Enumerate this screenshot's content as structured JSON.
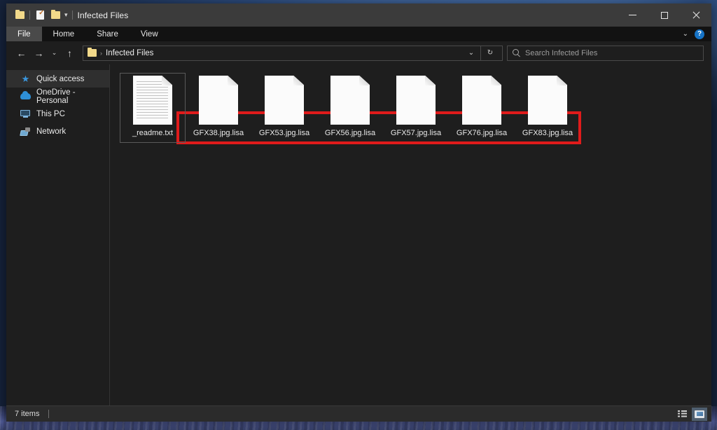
{
  "window": {
    "title": "Infected Files",
    "quick_access": [
      {
        "name": "folder-icon",
        "label": "Folder"
      },
      {
        "name": "properties-icon",
        "label": "Properties"
      },
      {
        "name": "new-folder-icon",
        "label": "New folder"
      },
      {
        "name": "customize-chevron-icon",
        "label": "Customize Quick Access Toolbar"
      }
    ],
    "controls": {
      "minimize": "Minimize",
      "maximize": "Maximize",
      "close": "Close"
    }
  },
  "ribbon": {
    "tabs": [
      {
        "label": "File",
        "active": true
      },
      {
        "label": "Home",
        "active": false
      },
      {
        "label": "Share",
        "active": false
      },
      {
        "label": "View",
        "active": false
      }
    ],
    "collapse_label": "Minimize the Ribbon",
    "help_label": "?"
  },
  "addressbar": {
    "back_label": "←",
    "forward_label": "→",
    "recent_label": "⌄",
    "up_label": "↑",
    "breadcrumb": {
      "separator": "›",
      "path": "Infected Files"
    },
    "dropdown_label": "⌄",
    "refresh_label": "↻"
  },
  "search": {
    "placeholder": "Search Infected Files",
    "value": ""
  },
  "sidebar": {
    "items": [
      {
        "label": "Quick access",
        "icon": "star-icon",
        "active": true
      },
      {
        "label": "OneDrive - Personal",
        "icon": "cloud-icon",
        "active": false
      },
      {
        "label": "This PC",
        "icon": "computer-icon",
        "active": false
      },
      {
        "label": "Network",
        "icon": "network-icon",
        "active": false
      }
    ]
  },
  "files": [
    {
      "name": "_readme.txt",
      "type": "text-document",
      "selected": true,
      "lined": true,
      "highlighted": false
    },
    {
      "name": "GFX38.jpg.lisa",
      "type": "unknown-file",
      "selected": false,
      "lined": false,
      "highlighted": true
    },
    {
      "name": "GFX53.jpg.lisa",
      "type": "unknown-file",
      "selected": false,
      "lined": false,
      "highlighted": true
    },
    {
      "name": "GFX56.jpg.lisa",
      "type": "unknown-file",
      "selected": false,
      "lined": false,
      "highlighted": true
    },
    {
      "name": "GFX57.jpg.lisa",
      "type": "unknown-file",
      "selected": false,
      "lined": false,
      "highlighted": true
    },
    {
      "name": "GFX76.jpg.lisa",
      "type": "unknown-file",
      "selected": false,
      "lined": false,
      "highlighted": true
    },
    {
      "name": "GFX83.jpg.lisa",
      "type": "unknown-file",
      "selected": false,
      "lined": false,
      "highlighted": true
    }
  ],
  "annotation": {
    "color": "#e01b1b",
    "shape": "rectangle"
  },
  "statusbar": {
    "item_count": "7 items",
    "views": [
      {
        "name": "details-view",
        "label": "Details view",
        "active": false
      },
      {
        "name": "large-icons-view",
        "label": "Large icons view",
        "active": true
      }
    ]
  },
  "colors": {
    "titlebar": "#3b3b3b",
    "window_bg": "#1e1e1e",
    "ribbon_bg": "#121212",
    "accent": "#1673c6",
    "annotation_red": "#e01b1b"
  }
}
